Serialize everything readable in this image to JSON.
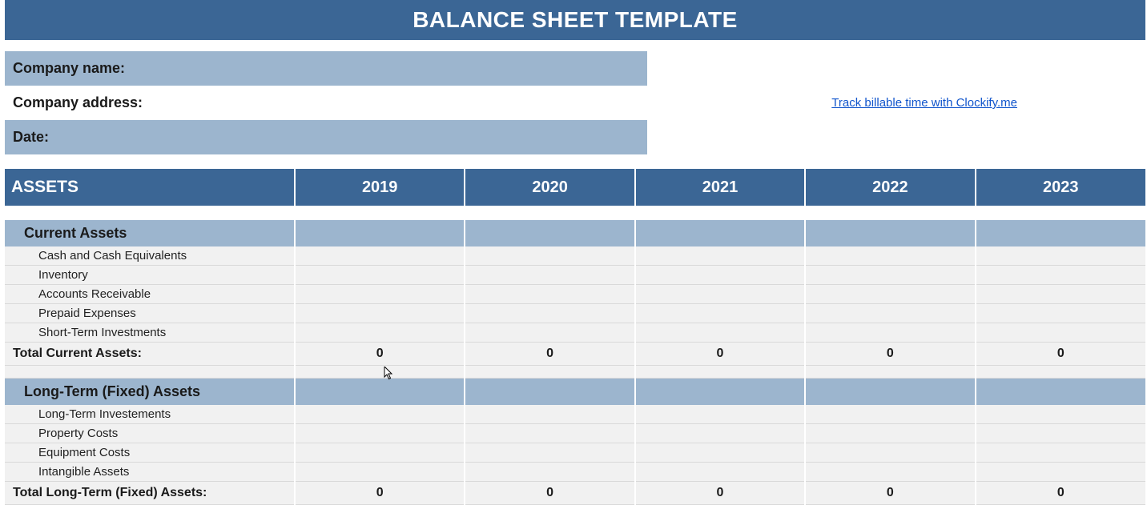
{
  "title": "BALANCE SHEET TEMPLATE",
  "info": {
    "company_name_label": "Company name:",
    "company_address_label": "Company address:",
    "date_label": "Date:"
  },
  "link_text": "Track billable time with Clockify.me",
  "table": {
    "header_label": "ASSETS",
    "years": [
      "2019",
      "2020",
      "2021",
      "2022",
      "2023"
    ],
    "sections": [
      {
        "title": "Current Assets",
        "items": [
          "Cash and Cash Equivalents",
          "Inventory",
          "Accounts Receivable",
          "Prepaid Expenses",
          "Short-Term Investments"
        ],
        "total_label": "Total Current Assets:",
        "totals": [
          "0",
          "0",
          "0",
          "0",
          "0"
        ]
      },
      {
        "title": "Long-Term (Fixed) Assets",
        "items": [
          "Long-Term Investements",
          "Property Costs",
          "Equipment Costs",
          "Intangible Assets"
        ],
        "total_label": "Total Long-Term (Fixed) Assets:",
        "totals": [
          "0",
          "0",
          "0",
          "0",
          "0"
        ]
      }
    ]
  }
}
